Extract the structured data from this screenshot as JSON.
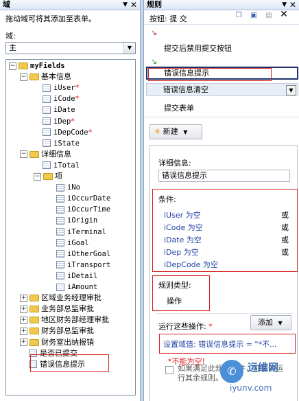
{
  "left_pane": {
    "title": "域",
    "description": "拖动域可将其添加至表单。",
    "domain_label": "域:",
    "domain_select": "主",
    "tree": [
      {
        "label": "myFields",
        "kind": "folder",
        "expander": "-",
        "level": 0,
        "bold": true
      },
      {
        "label": "基本信息",
        "kind": "folder",
        "expander": "-",
        "level": 1
      },
      {
        "label": "iUser",
        "kind": "field",
        "level": 2,
        "required": true
      },
      {
        "label": "iCode",
        "kind": "field",
        "level": 2,
        "required": true
      },
      {
        "label": "iDate",
        "kind": "field",
        "level": 2
      },
      {
        "label": "iDep",
        "kind": "field",
        "level": 2,
        "required": true
      },
      {
        "label": "iDepCode",
        "kind": "field",
        "level": 2,
        "required": true
      },
      {
        "label": "iState",
        "kind": "field",
        "level": 2
      },
      {
        "label": "详细信息",
        "kind": "folder",
        "expander": "-",
        "level": 1
      },
      {
        "label": "iTotal",
        "kind": "field",
        "level": 2
      },
      {
        "label": "项",
        "kind": "folder",
        "expander": "-",
        "level": 2
      },
      {
        "label": "iNo",
        "kind": "field",
        "level": 3
      },
      {
        "label": "iOccurDate",
        "kind": "field",
        "level": 3
      },
      {
        "label": "iOccurTime",
        "kind": "field",
        "level": 3
      },
      {
        "label": "iOrigin",
        "kind": "field",
        "level": 3
      },
      {
        "label": "iTerminal",
        "kind": "field",
        "level": 3
      },
      {
        "label": "iGoal",
        "kind": "field",
        "level": 3
      },
      {
        "label": "iOtherGoal",
        "kind": "field",
        "level": 3
      },
      {
        "label": "iTransport",
        "kind": "field",
        "level": 3
      },
      {
        "label": "iDetail",
        "kind": "field",
        "level": 3
      },
      {
        "label": "iAmount",
        "kind": "field",
        "level": 3
      },
      {
        "label": "区域业务经理审批",
        "kind": "folder",
        "expander": "+",
        "level": 1
      },
      {
        "label": "业务部总监审批",
        "kind": "folder",
        "expander": "+",
        "level": 1
      },
      {
        "label": "地区财务部经理审批",
        "kind": "folder",
        "expander": "+",
        "level": 1
      },
      {
        "label": "财务部总监审批",
        "kind": "folder",
        "expander": "+",
        "level": 1
      },
      {
        "label": "财务室出纳报销",
        "kind": "folder",
        "expander": "+",
        "level": 1
      },
      {
        "label": "是否已提交",
        "kind": "field",
        "level": 1
      },
      {
        "label": "错误信息提示",
        "kind": "field",
        "level": 1
      }
    ],
    "required_mark": "*"
  },
  "right_pane": {
    "title": "规则",
    "subtitle": "按钮: 提 交",
    "first_rule": "提交后禁用提交按钮",
    "rules": [
      "错误信息提示",
      "错误信息清空"
    ],
    "submit_rule": "提交表单",
    "new_button": "新建",
    "details_label": "详细信息:",
    "details_value": "错误信息提示",
    "conditions_label": "条件:",
    "conditions": [
      {
        "text": "iUser 为空",
        "joiner": "或"
      },
      {
        "text": "iCode 为空",
        "joiner": "或"
      },
      {
        "text": "iDate 为空",
        "joiner": "或"
      },
      {
        "text": "iDep 为空",
        "joiner": "或"
      },
      {
        "text": "iDepCode 为空",
        "joiner": ""
      }
    ],
    "rule_type_label": "规则类型:",
    "rule_type_value": "操作",
    "run_label": "运行这些操作:",
    "add_button": "添加",
    "action": "设置域值: 错误信息提示 = \"*不...",
    "note": "*不能为空!",
    "checkbox_label": "如果满足此规则条件，则请勿运行其余规则。",
    "watermark": "运维网",
    "watermark_url": "iyunv.com"
  }
}
